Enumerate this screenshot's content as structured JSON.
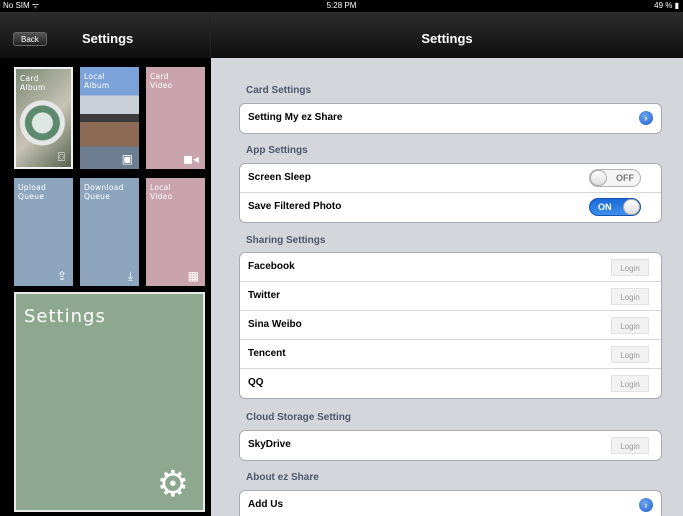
{
  "status_bar": {
    "carrier": "No SIM ᯤ",
    "time": "5:28 PM",
    "battery": "49 % ▮"
  },
  "left_nav": {
    "back_label": "Back",
    "title": "Settings"
  },
  "right_nav": {
    "title": "Settings"
  },
  "tiles": {
    "card_album": "Card\nAlbum",
    "local_album": "Local\nAlbum",
    "card_video": "Card\nVideo",
    "upload_queue": "Upload\nQueue",
    "download_queue": "Download\nQueue",
    "local_video": "Local\nVideo",
    "settings": "Settings"
  },
  "sections": {
    "card": {
      "header": "Card Settings",
      "rows": [
        "Setting My ez Share"
      ]
    },
    "app": {
      "header": "App Settings",
      "screen_sleep": "Screen Sleep",
      "screen_sleep_state": "OFF",
      "save_filtered": "Save Filtered Photo",
      "save_filtered_state": "ON"
    },
    "sharing": {
      "header": "Sharing Settings",
      "rows": [
        "Facebook",
        "Twitter",
        "Sina Weibo",
        "Tencent",
        "QQ"
      ],
      "login_label": "Login"
    },
    "cloud": {
      "header": "Cloud Storage Setting",
      "rows": [
        "SkyDrive"
      ],
      "login_label": "Login"
    },
    "about": {
      "header": "About ez Share",
      "rows": [
        "Add Us"
      ]
    }
  },
  "colors": {
    "accent": "#1a6ad8",
    "tile_blue": "#8da4bd",
    "tile_pink": "#c9a3ae",
    "tile_green": "#8ea88f"
  }
}
